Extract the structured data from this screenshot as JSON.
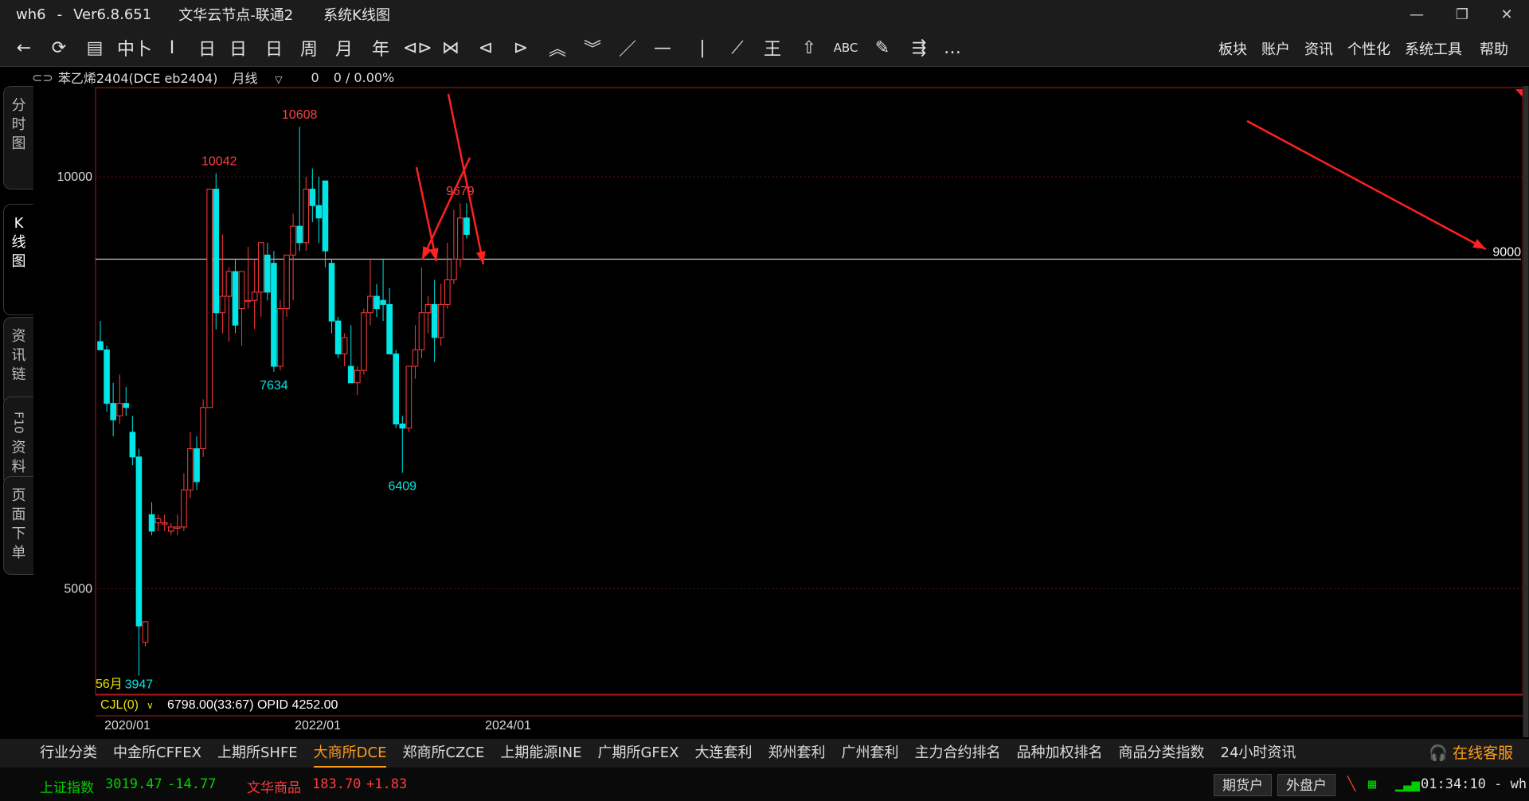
{
  "window": {
    "app": "wh6",
    "version": "Ver6.8.651",
    "node": "文华云节点-联通2",
    "view": "系统K线图",
    "sep": "-"
  },
  "toolbar": {
    "tools": [
      "←",
      "⟳",
      "▤",
      "中卜",
      "I",
      "日",
      "日",
      "日",
      "周",
      "月",
      "年",
      "⊲⊳",
      "⋈",
      "⊲",
      "⊳",
      "︽",
      "︾",
      "／",
      "—",
      "|",
      "⟋",
      "王",
      "⇧",
      "ABC",
      "✎",
      "⇶",
      "…"
    ],
    "menu": [
      "板块",
      "账户",
      "资讯",
      "个性化",
      "系统工具",
      "帮助"
    ]
  },
  "infobar": {
    "contract": "苯乙烯2404(DCE eb2404)",
    "period": "月线",
    "value": "0",
    "change": "0 / 0.00%"
  },
  "sidetabs": [
    {
      "label": "分时图"
    },
    {
      "label": "K线图"
    },
    {
      "label": "资讯链"
    },
    {
      "label": "F10资料"
    },
    {
      "label": "页面下单"
    }
  ],
  "chart_data": {
    "type": "candlestick",
    "period_label": "56月",
    "yticks": [
      10000,
      5000
    ],
    "xticks": [
      "2020/01",
      "2022/01",
      "2024/01"
    ],
    "ylim": [
      3700,
      11400
    ],
    "hline": {
      "value": 9000,
      "label": "9000"
    },
    "annotations": [
      {
        "text": "10042",
        "value": 10042
      },
      {
        "text": "10608",
        "value": 10608
      },
      {
        "text": "7634",
        "value": 7634
      },
      {
        "text": "9679",
        "value": 9679
      },
      {
        "text": "6409",
        "value": 6409
      },
      {
        "text": "3947",
        "value": 3947
      }
    ],
    "candles": [
      {
        "o": 8000,
        "h": 8250,
        "l": 7900,
        "c": 7900
      },
      {
        "o": 7900,
        "h": 7950,
        "l": 7150,
        "c": 7250
      },
      {
        "o": 7250,
        "h": 7500,
        "l": 6850,
        "c": 7050
      },
      {
        "o": 7100,
        "h": 7600,
        "l": 7000,
        "c": 7250
      },
      {
        "o": 7250,
        "h": 7450,
        "l": 7100,
        "c": 7200
      },
      {
        "o": 6900,
        "h": 7100,
        "l": 6500,
        "c": 6600
      },
      {
        "o": 6600,
        "h": 6700,
        "l": 3947,
        "c": 4550
      },
      {
        "o": 4350,
        "h": 4600,
        "l": 4300,
        "c": 4600
      },
      {
        "o": 5900,
        "h": 6050,
        "l": 5650,
        "c": 5700
      },
      {
        "o": 5800,
        "h": 5900,
        "l": 5700,
        "c": 5850
      },
      {
        "o": 5800,
        "h": 5900,
        "l": 5700,
        "c": 5800
      },
      {
        "o": 5700,
        "h": 5800,
        "l": 5650,
        "c": 5750
      },
      {
        "o": 5750,
        "h": 5900,
        "l": 5650,
        "c": 5750
      },
      {
        "o": 5750,
        "h": 6400,
        "l": 5700,
        "c": 6200
      },
      {
        "o": 6200,
        "h": 6900,
        "l": 6100,
        "c": 6700
      },
      {
        "o": 6700,
        "h": 6850,
        "l": 6200,
        "c": 6300
      },
      {
        "o": 6700,
        "h": 7300,
        "l": 6600,
        "c": 7200
      },
      {
        "o": 7200,
        "h": 9850,
        "l": 7200,
        "c": 9850
      },
      {
        "o": 9850,
        "h": 10042,
        "l": 8150,
        "c": 8350
      },
      {
        "o": 8350,
        "h": 9300,
        "l": 8100,
        "c": 8550
      },
      {
        "o": 8550,
        "h": 8900,
        "l": 8000,
        "c": 8850
      },
      {
        "o": 8850,
        "h": 9000,
        "l": 8100,
        "c": 8200
      },
      {
        "o": 8400,
        "h": 8850,
        "l": 7950,
        "c": 8850
      },
      {
        "o": 8500,
        "h": 9150,
        "l": 8400,
        "c": 8500
      },
      {
        "o": 8500,
        "h": 9000,
        "l": 8150,
        "c": 8600
      },
      {
        "o": 8600,
        "h": 9200,
        "l": 8300,
        "c": 9200
      },
      {
        "o": 9050,
        "h": 9200,
        "l": 8500,
        "c": 8600
      },
      {
        "o": 8950,
        "h": 9100,
        "l": 7634,
        "c": 7700
      },
      {
        "o": 7700,
        "h": 8500,
        "l": 7650,
        "c": 8400
      },
      {
        "o": 8400,
        "h": 9050,
        "l": 8300,
        "c": 9050
      },
      {
        "o": 9050,
        "h": 9550,
        "l": 8500,
        "c": 9400
      },
      {
        "o": 9400,
        "h": 10608,
        "l": 9100,
        "c": 9200
      },
      {
        "o": 9200,
        "h": 10000,
        "l": 9100,
        "c": 9850
      },
      {
        "o": 9850,
        "h": 10100,
        "l": 9450,
        "c": 9650
      },
      {
        "o": 9650,
        "h": 10000,
        "l": 9200,
        "c": 9500
      },
      {
        "o": 9950,
        "h": 9950,
        "l": 8900,
        "c": 9100
      },
      {
        "o": 8950,
        "h": 9000,
        "l": 8100,
        "c": 8250
      },
      {
        "o": 8250,
        "h": 8300,
        "l": 7800,
        "c": 7850
      },
      {
        "o": 7850,
        "h": 8100,
        "l": 7700,
        "c": 8050
      },
      {
        "o": 7700,
        "h": 8200,
        "l": 7550,
        "c": 7500
      },
      {
        "o": 7500,
        "h": 7700,
        "l": 7350,
        "c": 7650
      },
      {
        "o": 7650,
        "h": 8400,
        "l": 7600,
        "c": 8350
      },
      {
        "o": 8350,
        "h": 9000,
        "l": 8200,
        "c": 8550
      },
      {
        "o": 8550,
        "h": 8700,
        "l": 8300,
        "c": 8400
      },
      {
        "o": 8500,
        "h": 9000,
        "l": 8250,
        "c": 8450
      },
      {
        "o": 8450,
        "h": 8650,
        "l": 7900,
        "c": 7850
      },
      {
        "o": 7850,
        "h": 7900,
        "l": 6950,
        "c": 7000
      },
      {
        "o": 7000,
        "h": 7100,
        "l": 6409,
        "c": 6950
      },
      {
        "o": 6950,
        "h": 7700,
        "l": 6900,
        "c": 7700
      },
      {
        "o": 7700,
        "h": 8200,
        "l": 7550,
        "c": 7900
      },
      {
        "o": 7900,
        "h": 8900,
        "l": 7800,
        "c": 8350
      },
      {
        "o": 8350,
        "h": 8550,
        "l": 8100,
        "c": 8450
      },
      {
        "o": 8450,
        "h": 8750,
        "l": 7750,
        "c": 8050
      },
      {
        "o": 8050,
        "h": 8700,
        "l": 7950,
        "c": 8450
      },
      {
        "o": 8450,
        "h": 9200,
        "l": 8400,
        "c": 8750
      },
      {
        "o": 8750,
        "h": 9600,
        "l": 8700,
        "c": 9000
      },
      {
        "o": 9000,
        "h": 9679,
        "l": 8900,
        "c": 9500
      },
      {
        "o": 9500,
        "h": 9679,
        "l": 9250,
        "c": 9300
      }
    ],
    "candle_overrides_note": "",
    "subpanel": {
      "name": "CJL(0)",
      "text": "6798.00(33:67)  OPID 4252.00"
    },
    "colors": {
      "up": "#ff3b3b",
      "down": "#00e5e5",
      "frame": "#b51a1a",
      "grid": "#5a1414",
      "hline": "#c8c8c8",
      "label_up": "#ff4040",
      "label_down": "#00e5e5",
      "period": "#e8e000"
    }
  },
  "market_tabs": [
    "行业分类",
    "中金所CFFEX",
    "上期所SHFE",
    "大商所DCE",
    "郑商所CZCE",
    "上期能源INE",
    "广期所GFEX",
    "大连套利",
    "郑州套利",
    "广州套利",
    "主力合约排名",
    "品种加权排名",
    "商品分类指数",
    "24小时资讯"
  ],
  "active_market_tab": "大商所DCE",
  "service": "在线客服",
  "status": {
    "index1_name": "上证指数",
    "index1_value": "3019.47",
    "index1_change": "-14.77",
    "index2_name": "文华商品",
    "index2_value": "183.70",
    "index2_change": "+1.83",
    "btn_futures": "期货户",
    "btn_foreign": "外盘户",
    "time": "01:34:10 - wh",
    "colors": {
      "down": "#00d000",
      "up": "#ff3b3b"
    }
  }
}
